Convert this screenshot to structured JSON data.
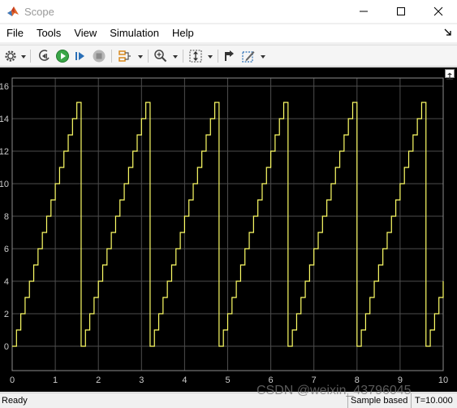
{
  "window": {
    "title": "Scope"
  },
  "menu": {
    "items": [
      "File",
      "Tools",
      "View",
      "Simulation",
      "Help"
    ]
  },
  "toolbar": {
    "icons": [
      "settings-icon",
      "step-back-icon",
      "run-icon",
      "step-forward-icon",
      "stop-icon",
      "signal-selector-icon",
      "zoom-icon",
      "autoscale-icon",
      "highlight-icon",
      "style-icon"
    ]
  },
  "status": {
    "ready": "Ready",
    "mode": "Sample based",
    "time": "T=10.000"
  },
  "watermark": "CSDN @weixin_43796045",
  "colors": {
    "plot_bg": "#000000",
    "axes_bg": "#000000",
    "grid": "#4d4d4d",
    "signal": "#ffff66",
    "tick_text": "#cccccc"
  },
  "chart_data": {
    "type": "line",
    "title": "",
    "xlabel": "",
    "ylabel": "",
    "xlim": [
      0,
      10
    ],
    "ylim": [
      -1.5,
      16.5
    ],
    "xticks": [
      0,
      1,
      2,
      3,
      4,
      5,
      6,
      7,
      8,
      9,
      10
    ],
    "yticks": [
      0,
      2,
      4,
      6,
      8,
      10,
      12,
      14,
      16
    ],
    "grid": true,
    "line_style": "step",
    "sample_time": 0.1,
    "x": [
      0.0,
      0.1,
      0.2,
      0.3,
      0.4,
      0.5,
      0.6,
      0.7,
      0.8,
      0.9,
      1.0,
      1.1,
      1.2,
      1.3,
      1.4,
      1.5,
      1.6,
      1.7,
      1.8,
      1.9,
      2.0,
      2.1,
      2.2,
      2.3,
      2.4,
      2.5,
      2.6,
      2.7,
      2.8,
      2.9,
      3.0,
      3.1,
      3.2,
      3.3,
      3.4,
      3.5,
      3.6,
      3.7,
      3.8,
      3.9,
      4.0,
      4.1,
      4.2,
      4.3,
      4.4,
      4.5,
      4.6,
      4.7,
      4.8,
      4.9,
      5.0,
      5.1,
      5.2,
      5.3,
      5.4,
      5.5,
      5.6,
      5.7,
      5.8,
      5.9,
      6.0,
      6.1,
      6.2,
      6.3,
      6.4,
      6.5,
      6.6,
      6.7,
      6.8,
      6.9,
      7.0,
      7.1,
      7.2,
      7.3,
      7.4,
      7.5,
      7.6,
      7.7,
      7.8,
      7.9,
      8.0,
      8.1,
      8.2,
      8.3,
      8.4,
      8.5,
      8.6,
      8.7,
      8.8,
      8.9,
      9.0,
      9.1,
      9.2,
      9.3,
      9.4,
      9.5,
      9.6,
      9.7,
      9.8,
      9.9,
      10.0
    ],
    "series": [
      {
        "values": [
          0,
          1,
          2,
          3,
          4,
          5,
          6,
          7,
          8,
          9,
          10,
          11,
          12,
          13,
          14,
          15,
          0,
          1,
          2,
          3,
          4,
          5,
          6,
          7,
          8,
          9,
          10,
          11,
          12,
          13,
          14,
          15,
          0,
          1,
          2,
          3,
          4,
          5,
          6,
          7,
          8,
          9,
          10,
          11,
          12,
          13,
          14,
          15,
          0,
          1,
          2,
          3,
          4,
          5,
          6,
          7,
          8,
          9,
          10,
          11,
          12,
          13,
          14,
          15,
          0,
          1,
          2,
          3,
          4,
          5,
          6,
          7,
          8,
          9,
          10,
          11,
          12,
          13,
          14,
          15,
          0,
          1,
          2,
          3,
          4,
          5,
          6,
          7,
          8,
          9,
          10,
          11,
          12,
          13,
          14,
          15,
          0,
          1,
          2,
          3,
          4
        ]
      }
    ]
  }
}
